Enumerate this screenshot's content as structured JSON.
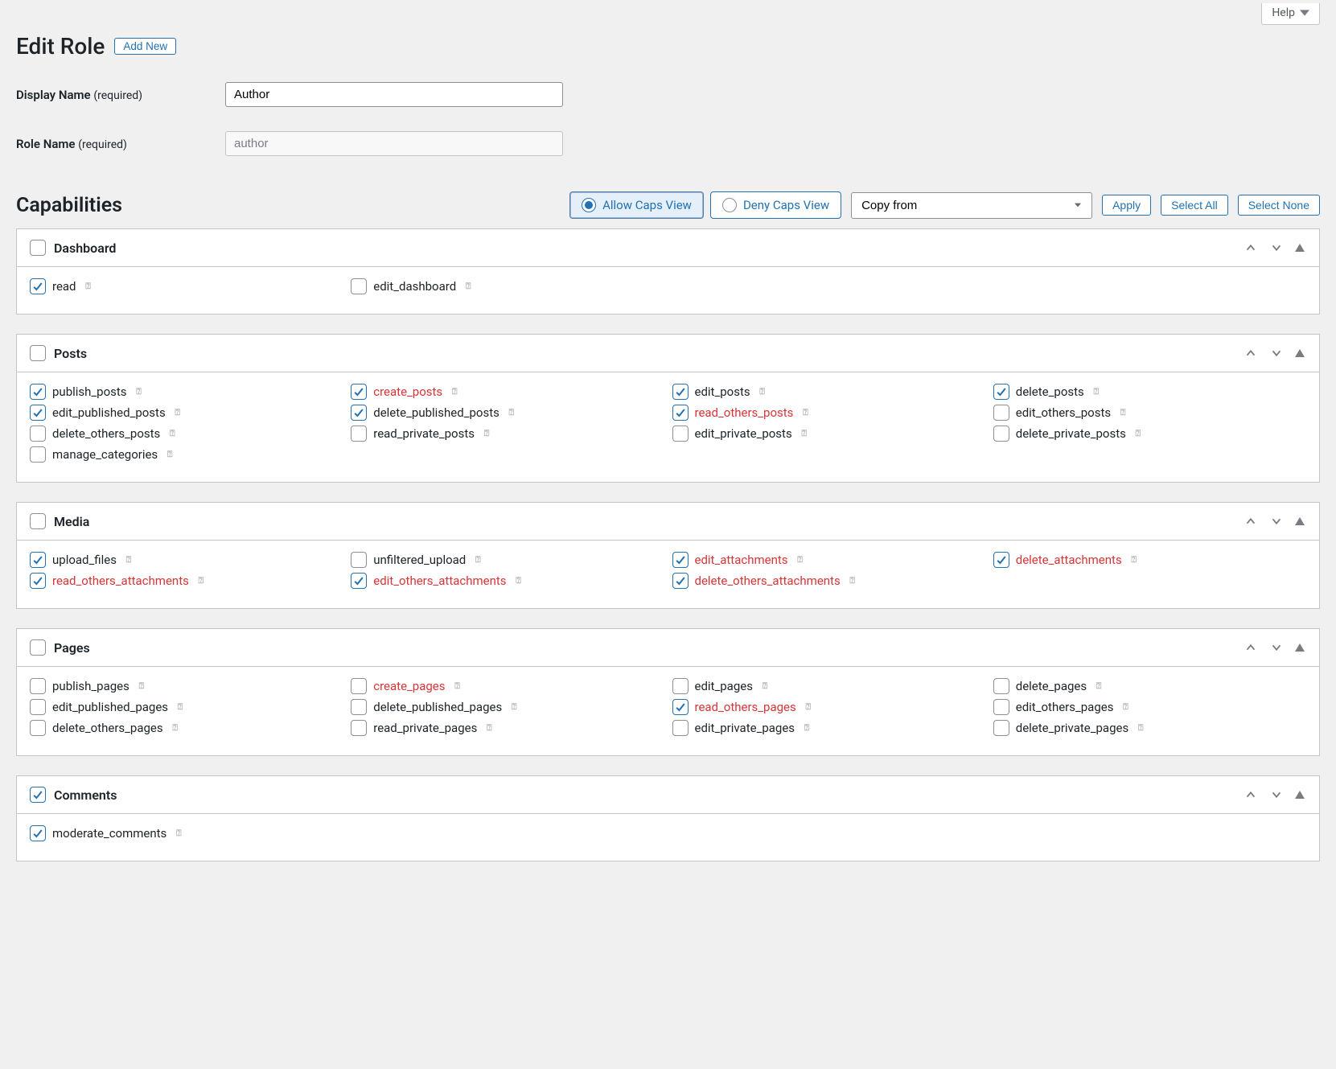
{
  "help_label": "Help",
  "page_title": "Edit Role",
  "add_new": "Add New",
  "display_name_label": "Display Name",
  "role_name_label": "Role Name",
  "required_suffix": "(required)",
  "display_name_value": "Author",
  "role_name_value": "author",
  "capabilities_heading": "Capabilities",
  "view_allow": "Allow Caps View",
  "view_deny": "Deny Caps View",
  "copy_from_placeholder": "Copy from",
  "apply": "Apply",
  "select_all": "Select All",
  "select_none": "Select None",
  "sections": [
    {
      "title": "Dashboard",
      "group_checked": false,
      "caps": [
        {
          "name": "read",
          "checked": true,
          "negated": false
        },
        {
          "name": "edit_dashboard",
          "checked": false,
          "negated": false
        }
      ]
    },
    {
      "title": "Posts",
      "group_checked": false,
      "caps": [
        {
          "name": "publish_posts",
          "checked": true,
          "negated": false
        },
        {
          "name": "create_posts",
          "checked": true,
          "negated": true
        },
        {
          "name": "edit_posts",
          "checked": true,
          "negated": false
        },
        {
          "name": "delete_posts",
          "checked": true,
          "negated": false
        },
        {
          "name": "edit_published_posts",
          "checked": true,
          "negated": false
        },
        {
          "name": "delete_published_posts",
          "checked": true,
          "negated": false
        },
        {
          "name": "read_others_posts",
          "checked": true,
          "negated": true
        },
        {
          "name": "edit_others_posts",
          "checked": false,
          "negated": false
        },
        {
          "name": "delete_others_posts",
          "checked": false,
          "negated": false
        },
        {
          "name": "read_private_posts",
          "checked": false,
          "negated": false
        },
        {
          "name": "edit_private_posts",
          "checked": false,
          "negated": false
        },
        {
          "name": "delete_private_posts",
          "checked": false,
          "negated": false
        },
        {
          "name": "manage_categories",
          "checked": false,
          "negated": false
        }
      ]
    },
    {
      "title": "Media",
      "group_checked": false,
      "caps": [
        {
          "name": "upload_files",
          "checked": true,
          "negated": false
        },
        {
          "name": "unfiltered_upload",
          "checked": false,
          "negated": false
        },
        {
          "name": "edit_attachments",
          "checked": true,
          "negated": true
        },
        {
          "name": "delete_attachments",
          "checked": true,
          "negated": true
        },
        {
          "name": "read_others_attachments",
          "checked": true,
          "negated": true
        },
        {
          "name": "edit_others_attachments",
          "checked": true,
          "negated": true
        },
        {
          "name": "delete_others_attachments",
          "checked": true,
          "negated": true
        }
      ]
    },
    {
      "title": "Pages",
      "group_checked": false,
      "caps": [
        {
          "name": "publish_pages",
          "checked": false,
          "negated": false
        },
        {
          "name": "create_pages",
          "checked": false,
          "negated": true
        },
        {
          "name": "edit_pages",
          "checked": false,
          "negated": false
        },
        {
          "name": "delete_pages",
          "checked": false,
          "negated": false
        },
        {
          "name": "edit_published_pages",
          "checked": false,
          "negated": false
        },
        {
          "name": "delete_published_pages",
          "checked": false,
          "negated": false
        },
        {
          "name": "read_others_pages",
          "checked": true,
          "negated": true
        },
        {
          "name": "edit_others_pages",
          "checked": false,
          "negated": false
        },
        {
          "name": "delete_others_pages",
          "checked": false,
          "negated": false
        },
        {
          "name": "read_private_pages",
          "checked": false,
          "negated": false
        },
        {
          "name": "edit_private_pages",
          "checked": false,
          "negated": false
        },
        {
          "name": "delete_private_pages",
          "checked": false,
          "negated": false
        }
      ]
    },
    {
      "title": "Comments",
      "group_checked": true,
      "caps": [
        {
          "name": "moderate_comments",
          "checked": true,
          "negated": false
        }
      ]
    }
  ]
}
